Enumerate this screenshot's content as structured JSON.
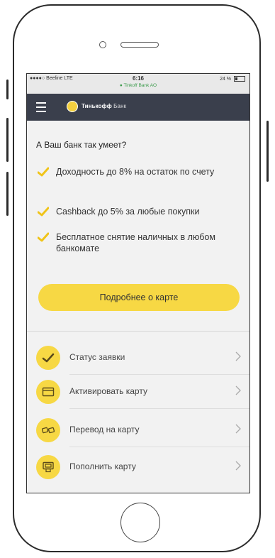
{
  "status_bar": {
    "carrier": "●●●●○ Beeline  LTE",
    "time": "6:16",
    "subtitle": "● Tinkoff Bank AO",
    "battery": "24 %"
  },
  "app_bar": {
    "logo_bold": "Тинькофф",
    "logo_light": " Банк"
  },
  "promo": {
    "headline": "А Ваш банк так умеет?",
    "features": [
      "Доходность до 8% на остаток по счету",
      "Cashback до 5% за любые покупки",
      "Бесплатное снятие наличных в любом банкомате"
    ],
    "cta_label": "Подробнее о карте"
  },
  "actions": [
    {
      "label": "Статус заявки",
      "icon": "checkmark-icon"
    },
    {
      "label": "Активировать карту",
      "icon": "card-icon"
    },
    {
      "label": "Перевод на карту",
      "icon": "transfer-icon"
    },
    {
      "label": "Пополнить карту",
      "icon": "atm-icon"
    }
  ],
  "colors": {
    "accent": "#f7d844",
    "header": "#3a3f4c",
    "check": "#f0c419"
  }
}
